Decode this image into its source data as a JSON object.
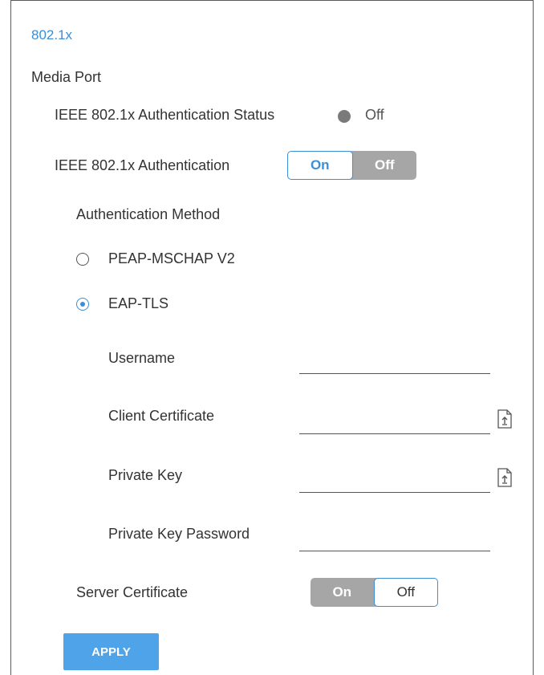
{
  "header": {
    "title": "802.1x"
  },
  "section": {
    "title": "Media Port"
  },
  "auth_status": {
    "label": "IEEE 802.1x Authentication Status",
    "value": "Off"
  },
  "auth_toggle": {
    "label": "IEEE 802.1x Authentication",
    "on_label": "On",
    "off_label": "Off",
    "selected": "On"
  },
  "method": {
    "label": "Authentication Method",
    "options": [
      {
        "label": "PEAP-MSCHAP V2",
        "selected": false
      },
      {
        "label": "EAP-TLS",
        "selected": true
      }
    ]
  },
  "fields": {
    "username": {
      "label": "Username",
      "value": ""
    },
    "client_certificate": {
      "label": "Client Certificate",
      "value": ""
    },
    "private_key": {
      "label": "Private Key",
      "value": ""
    },
    "private_key_password": {
      "label": "Private Key Password",
      "value": ""
    }
  },
  "server_certificate": {
    "label": "Server Certificate",
    "on_label": "On",
    "off_label": "Off",
    "selected": "Off"
  },
  "actions": {
    "apply_label": "APPLY"
  },
  "colors": {
    "accent": "#3a8fd6",
    "button": "#4fa3e8",
    "toggle_inactive": "#a6a6a6"
  },
  "icons": {
    "status": "status-dot-icon",
    "upload": "file-upload-icon"
  }
}
